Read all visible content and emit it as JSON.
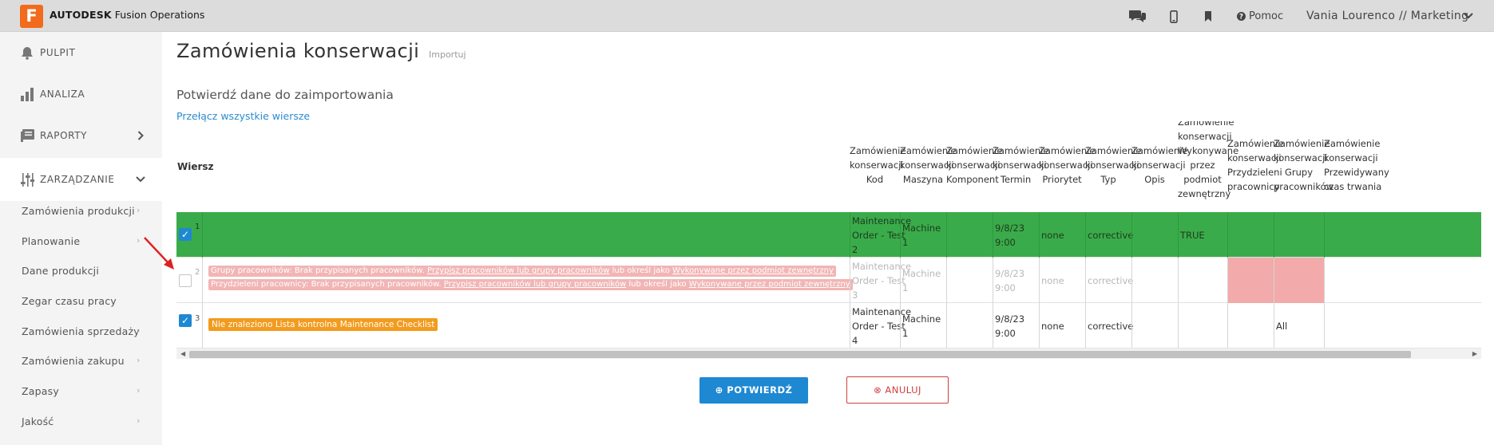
{
  "app": {
    "logo_letter": "F",
    "brand_bold": "AUTODESK",
    "brand_rest": " Fusion Operations"
  },
  "topbar": {
    "help_label": "Pomoc",
    "user": "Vania Lourenco // Marketing",
    "icons": [
      "chat-icon",
      "mobile-icon",
      "bookmark-icon",
      "help-icon"
    ]
  },
  "sidebar": {
    "main": [
      {
        "label": "PULPIT",
        "icon": "bell-icon"
      },
      {
        "label": "ANALIZA",
        "icon": "bar-chart-icon"
      },
      {
        "label": "RAPORTY",
        "icon": "report-icon"
      },
      {
        "label": "ZARZĄDZANIE",
        "icon": "sliders-icon"
      }
    ],
    "sub": [
      "Zamówienia produkcji",
      "Planowanie",
      "Dane produkcji",
      "Zegar czasu pracy",
      "Zamówienia sprzedaży",
      "Zamówienia zakupu",
      "Zapasy",
      "Jakość"
    ]
  },
  "page": {
    "title": "Zamówienia konserwacji",
    "subtitle": "Importuj",
    "confirm_title": "Potwierdź dane do zaimportowania",
    "toggle_link": "Przełącz wszystkie wiersze"
  },
  "table": {
    "row_header": "Wiersz",
    "columns": [
      [
        "Zamówienie",
        "konserwacji",
        "Kod"
      ],
      [
        "Zamówienie",
        "konserwacji",
        "Maszyna"
      ],
      [
        "Zamówienie",
        "konserwacji",
        "Komponent"
      ],
      [
        "Zamówienie",
        "konserwacji",
        "Termin"
      ],
      [
        "Zamówienie",
        "konserwacji",
        "Priorytet"
      ],
      [
        "Zamówienie",
        "konserwacji",
        "Typ"
      ],
      [
        "Zamówienie",
        "konserwacji",
        "Opis"
      ],
      [
        "Zamówienie",
        "konserwacji",
        "Wykonywane",
        "przez",
        "podmiot",
        "zewnętrzny"
      ],
      [
        "Zamówienie",
        "konserwacji",
        "Przydzieleni",
        "pracownicy"
      ],
      [
        "Zamówienie",
        "konserwacji",
        "Grupy",
        "pracowników"
      ],
      [
        "Zamówienie",
        "konserwacji",
        "Przewidywany",
        "czas trwania"
      ]
    ],
    "rows": [
      {
        "num": "1",
        "checked": true,
        "status": "ok",
        "cells": [
          "Maintenance Order - Test 2",
          "Machine 1",
          "",
          "9/8/23 9:00",
          "none",
          "corrective",
          "",
          "TRUE",
          "",
          "",
          ""
        ]
      },
      {
        "num": "2",
        "checked": false,
        "status": "error",
        "errors": [
          {
            "text": "Grupy pracowników: Brak przypisanych pracowników. ",
            "link1": "Przypisz pracowników lub grupy pracowników",
            "mid": " lub określ jako ",
            "link2": "Wykonywane przez podmiot zewnętrzny"
          },
          {
            "text": "Przydzieleni pracownicy: Brak przypisanych pracowników. ",
            "link1": "Przypisz pracowników lub grupy pracowników",
            "mid": " lub określ jako ",
            "link2": "Wykonywane przez podmiot zewnętrzny"
          }
        ],
        "cells": [
          "Maintenance Order - Test 3",
          "Machine 1",
          "",
          "9/8/23 9:00",
          "none",
          "corrective",
          "",
          "",
          "",
          "",
          ""
        ]
      },
      {
        "num": "3",
        "checked": true,
        "status": "warning",
        "warning": "Nie znaleziono Lista kontrolna Maintenance Checklist",
        "cells": [
          "Maintenance Order - Test 4",
          "Machine 1",
          "",
          "9/8/23 9:00",
          "none",
          "corrective",
          "",
          "",
          "",
          "All",
          ""
        ]
      }
    ]
  },
  "buttons": {
    "confirm": "POTWIERDŹ",
    "cancel": "ANULUJ"
  },
  "colors": {
    "accent": "#1e88d2",
    "success_row": "#3aab4a",
    "error_cell": "#f2aaaa",
    "warning": "#f39b1e",
    "cancel": "#d03d3d",
    "logo": "#f26a1b"
  }
}
